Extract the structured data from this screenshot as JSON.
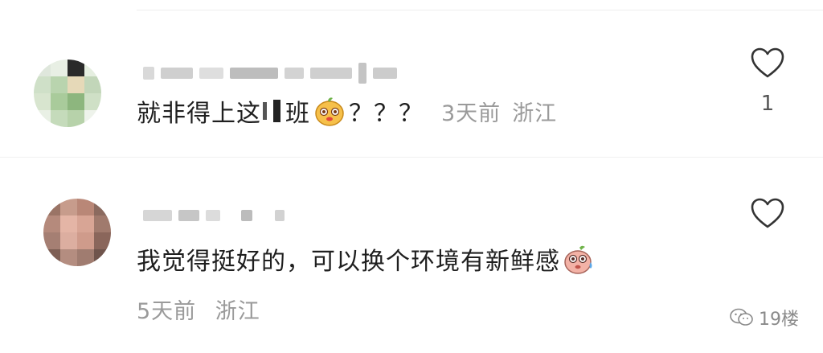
{
  "comments": [
    {
      "text_before": "就非得上这",
      "text_after": "班",
      "text_end": "？？？",
      "time": "3天前",
      "location": "浙江",
      "like_count": "1"
    },
    {
      "text": "我觉得挺好的，可以换个环境有新鲜感",
      "time": "5天前",
      "location": "浙江",
      "like_count": ""
    }
  ],
  "watermark": {
    "label": "19楼"
  },
  "icons": [
    "heart-outline-icon",
    "wechat-icon"
  ],
  "colors": {
    "meta_gray": "#9a9a9a",
    "divider": "#eeeeee"
  }
}
